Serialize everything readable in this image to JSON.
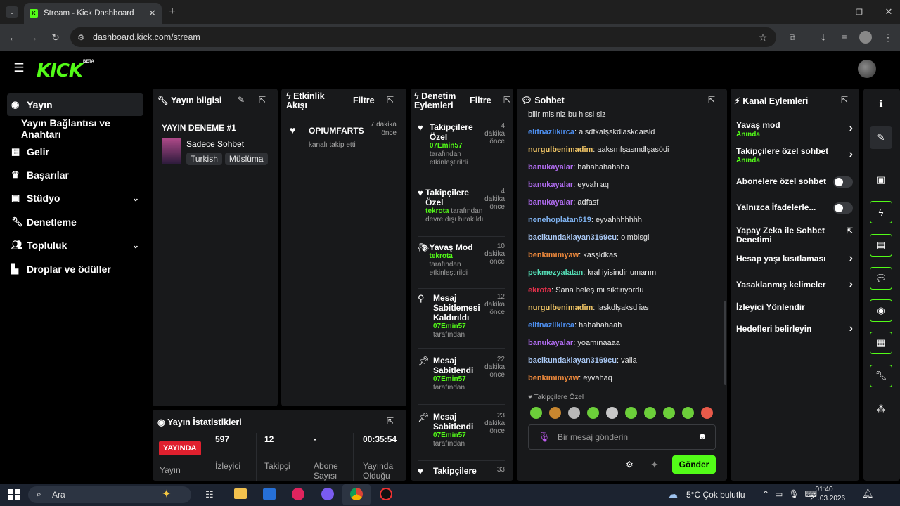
{
  "browser": {
    "tab_title": "Stream - Kick Dashboard",
    "url": "dashboard.kick.com/stream"
  },
  "header": {
    "logo": "KICK",
    "beta": "BETA"
  },
  "sidebar": {
    "items": [
      {
        "label": "Yayın",
        "icon": "broadcast-icon"
      },
      {
        "label": "Yayın Bağlantısı ve Anahtarı"
      },
      {
        "label": "Gelir",
        "icon": "chart-icon"
      },
      {
        "label": "Başarılar",
        "icon": "trophy-icon"
      },
      {
        "label": "Stüdyo",
        "icon": "studio-icon"
      },
      {
        "label": "Denetleme",
        "icon": "wrench-icon"
      },
      {
        "label": "Topluluk",
        "icon": "people-icon"
      },
      {
        "label": "Droplar ve ödüller",
        "icon": "gift-icon"
      }
    ]
  },
  "stream_info": {
    "title": "Yayın bilgisi",
    "stream_title": "YAYIN DENEME #1",
    "category": "Sadece Sohbet",
    "tags": [
      "Turkish",
      "Müslüma"
    ]
  },
  "activity": {
    "title": "Etkinlik Akışı",
    "filter": "Filtre",
    "user": "OPIUMFARTS",
    "time": "7 dakika önce",
    "desc": "kanalı takip etti"
  },
  "mod": {
    "title": "Denetim Eylemleri",
    "filter": "Filtre",
    "actions": [
      {
        "title": "Takipçilere Özel",
        "time": "4 dakika önce",
        "user": "07Emin57",
        "desc": "tarafından etkinleştirildi"
      },
      {
        "title": "Takipçilere Özel",
        "time": "4 dakika önce",
        "user": "tekrota",
        "desc": "tarafından devre dışı bırakıldı"
      },
      {
        "title": "Yavaş Mod",
        "time": "10 dakika önce",
        "user": "tekrota",
        "desc": "tarafından etkinleştirildi"
      },
      {
        "title": "Mesaj Sabitlemesi Kaldırıldı",
        "time": "12 dakika önce",
        "user": "07Emin57",
        "desc": "tarafından"
      },
      {
        "title": "Mesaj Sabitlendi",
        "time": "22 dakika önce",
        "user": "07Emin57",
        "desc": "tarafından"
      },
      {
        "title": "Mesaj Sabitlendi",
        "time": "23 dakika önce",
        "user": "07Emin57",
        "desc": "tarafından"
      },
      {
        "title": "Takipçilere",
        "time": "33"
      }
    ]
  },
  "chat": {
    "title": "Sohbet",
    "messages": [
      {
        "user": "",
        "text": "bilir misiniz bu hissi siz",
        "color": "#e6e6e6"
      },
      {
        "user": "elifnazlikirca",
        "text": "alsdfkalşskdlaskdaisld",
        "color": "#4d8ff0"
      },
      {
        "user": "nurgulbenimadim",
        "text": "aaksmfşasmdlşasödi",
        "color": "#f3c766"
      },
      {
        "user": "banukayalar",
        "text": "hahahahahaha",
        "color": "#b06cf0"
      },
      {
        "user": "banukayalar",
        "text": "eyvah aq",
        "color": "#b06cf0"
      },
      {
        "user": "banukayalar",
        "text": "adfasf",
        "color": "#b06cf0"
      },
      {
        "user": "nenehoplatan619",
        "text": "eyvahhhhhhh",
        "color": "#7fb2f0"
      },
      {
        "user": "bacikundaklayan3169cu",
        "text": "olmbisgi",
        "color": "#a9c8f5"
      },
      {
        "user": "benkimimyaw",
        "text": "kasşldkas",
        "color": "#f08a3c"
      },
      {
        "user": "pekmezyalatan",
        "text": "kral iyisindir umarım",
        "color": "#55e0b8"
      },
      {
        "user": "ekrota",
        "text": "Sana beleş mi siktiriyordu",
        "color": "#e5304b"
      },
      {
        "user": "nurgulbenimadim",
        "text": "laskdlşaksdlias",
        "color": "#f3c766"
      },
      {
        "user": "elifnazlikirca",
        "text": "hahahahaah",
        "color": "#4d8ff0"
      },
      {
        "user": "banukayalar",
        "text": "yoamınaaaa",
        "color": "#b06cf0"
      },
      {
        "user": "bacikundaklayan3169cu",
        "text": "valla",
        "color": "#a9c8f5"
      },
      {
        "user": "benkimimyaw",
        "text": "eyvahaq",
        "color": "#f08a3c"
      }
    ],
    "mode_label": "Takipçilere Özel",
    "placeholder": "Bir mesaj gönderin",
    "send": "Gönder"
  },
  "channel": {
    "title": "Kanal Eylemleri",
    "items": [
      {
        "label": "Yavaş mod",
        "sub": "Anında",
        "kind": "chev"
      },
      {
        "label": "Takipçilere özel sohbet",
        "sub": "Anında",
        "kind": "chev"
      },
      {
        "label": "Abonelere özel sohbet",
        "kind": "toggle"
      },
      {
        "label": "Yalnızca İfadelerle...",
        "kind": "toggle"
      },
      {
        "label": "Yapay Zeka ile Sohbet Denetimi",
        "kind": "ext"
      },
      {
        "label": "Hesap yaşı kısıtlaması",
        "kind": "chev"
      },
      {
        "label": "Yasaklanmış kelimeler",
        "kind": "chev"
      },
      {
        "label": "İzleyici Yönlendir",
        "kind": "none"
      },
      {
        "label": "Hedefleri belirleyin",
        "kind": "chev"
      }
    ]
  },
  "stats": {
    "title": "Yayın İstatistikleri",
    "live": "YAYINDA",
    "items": [
      {
        "value": "597",
        "label": "İzleyici"
      },
      {
        "value": "12",
        "label": "Takipçi"
      },
      {
        "value": "-",
        "label": "Abone Sayısı"
      },
      {
        "value": "00:35:54",
        "label": "Yayında Olduğu"
      }
    ],
    "first_label": "Yayın"
  },
  "taskbar": {
    "search": "Ara",
    "weather": "5°C  Çok bulutlu",
    "time": "01:40",
    "date": "21.03.2026"
  }
}
